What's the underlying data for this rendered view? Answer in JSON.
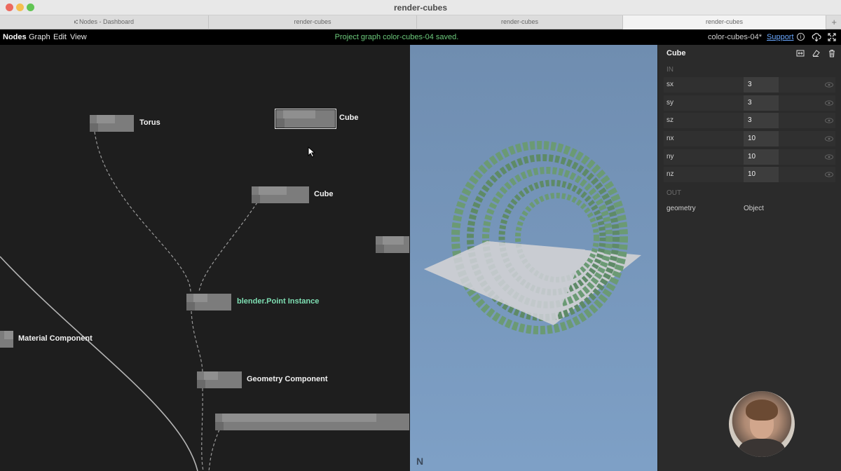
{
  "window": {
    "title": "render-cubes",
    "tabs": [
      {
        "label": "Nodes - Dashboard",
        "icon": "nodes-logo-icon"
      },
      {
        "label": "render-cubes"
      },
      {
        "label": "render-cubes"
      },
      {
        "label": "render-cubes"
      }
    ],
    "add_tab": "+"
  },
  "menubar": {
    "brand": "Nodes",
    "items": [
      "Graph",
      "Edit",
      "View"
    ],
    "status_message": "Project graph color-cubes-04 saved.",
    "project_name": "color-cubes-04*",
    "support_label": "Support",
    "info_glyph": "i",
    "icons": [
      "info-icon",
      "cloud-download-icon",
      "fullscreen-icon"
    ]
  },
  "graph": {
    "nodes": [
      {
        "label": "Torus"
      },
      {
        "label": "Cube"
      },
      {
        "label": "Cube"
      },
      {
        "label": "blender.Point Instance"
      },
      {
        "label": "Material Component"
      },
      {
        "label": "Geometry Component"
      }
    ]
  },
  "viewer": {
    "logo": "N",
    "model_color": "#6b9a74",
    "plane_color": "#c9ccd1"
  },
  "inspector": {
    "title": "Cube",
    "icons": [
      "fit-view-icon",
      "eraser-icon",
      "trash-icon"
    ],
    "in_label": "IN",
    "out_label": "OUT",
    "inputs": [
      {
        "name": "sx",
        "value": "3"
      },
      {
        "name": "sy",
        "value": "3"
      },
      {
        "name": "sz",
        "value": "3"
      },
      {
        "name": "nx",
        "value": "10"
      },
      {
        "name": "ny",
        "value": "10"
      },
      {
        "name": "nz",
        "value": "10"
      }
    ],
    "outputs": [
      {
        "name": "geometry",
        "type": "Object"
      }
    ]
  },
  "colors": {
    "accent_green": "#6cc97b",
    "node_accent": "#7fe0b4",
    "link_blue": "#6aa8ff"
  }
}
